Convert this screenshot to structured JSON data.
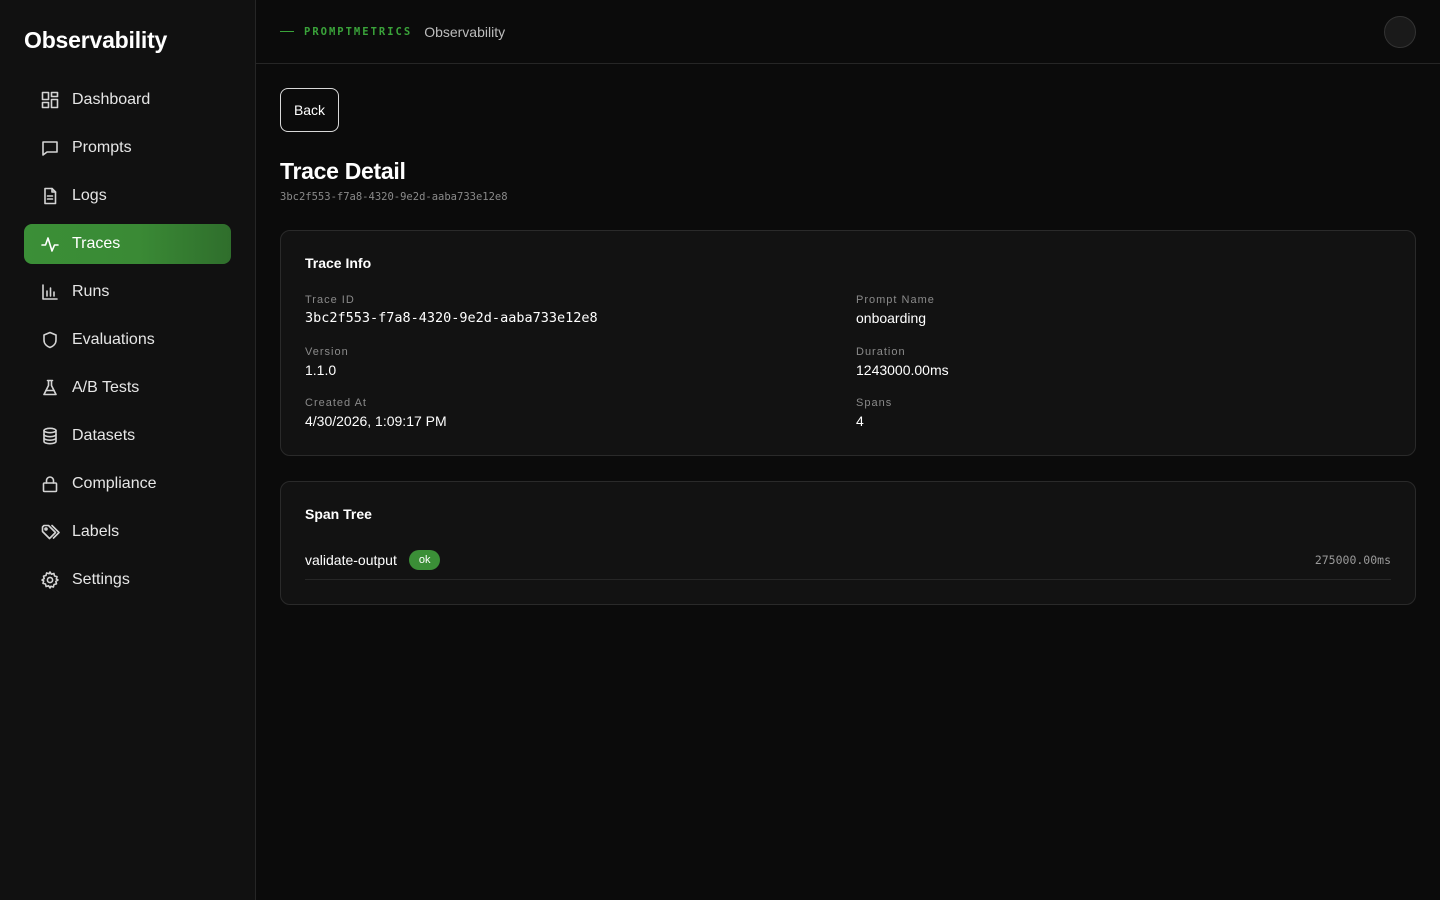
{
  "app": {
    "title": "Observability"
  },
  "sidebar": {
    "items": [
      {
        "label": "Dashboard",
        "icon": "dashboard-icon"
      },
      {
        "label": "Prompts",
        "icon": "chat-bubble-icon"
      },
      {
        "label": "Logs",
        "icon": "document-icon"
      },
      {
        "label": "Traces",
        "icon": "activity-pulse-icon",
        "active": true
      },
      {
        "label": "Runs",
        "icon": "bar-chart-icon"
      },
      {
        "label": "Evaluations",
        "icon": "shield-icon"
      },
      {
        "label": "A/B Tests",
        "icon": "flask-icon"
      },
      {
        "label": "Datasets",
        "icon": "database-icon"
      },
      {
        "label": "Compliance",
        "icon": "lock-icon"
      },
      {
        "label": "Labels",
        "icon": "tags-icon"
      },
      {
        "label": "Settings",
        "icon": "gear-icon"
      }
    ]
  },
  "topbar": {
    "org": "PROMPTMETRICS",
    "section": "Observability"
  },
  "page": {
    "back_label": "Back",
    "title": "Trace Detail",
    "subtitle": "3bc2f553-f7a8-4320-9e2d-aaba733e12e8"
  },
  "trace_info": {
    "title": "Trace Info",
    "trace_id": {
      "label": "Trace ID",
      "value": "3bc2f553-f7a8-4320-9e2d-aaba733e12e8"
    },
    "prompt_name": {
      "label": "Prompt Name",
      "value": "onboarding"
    },
    "version": {
      "label": "Version",
      "value": "1.1.0"
    },
    "duration": {
      "label": "Duration",
      "value": "1243000.00ms"
    },
    "created_at": {
      "label": "Created At",
      "value": "4/30/2026, 1:09:17 PM"
    },
    "spans": {
      "label": "Spans",
      "value": "4"
    }
  },
  "span_tree": {
    "title": "Span Tree",
    "spans": [
      {
        "name": "validate-output",
        "status": "ok",
        "duration": "275000.00ms"
      }
    ]
  },
  "colors": {
    "accent": "#3b8f37",
    "background": "#0b0b0b",
    "sidebar": "#111111",
    "card": "#121212"
  }
}
